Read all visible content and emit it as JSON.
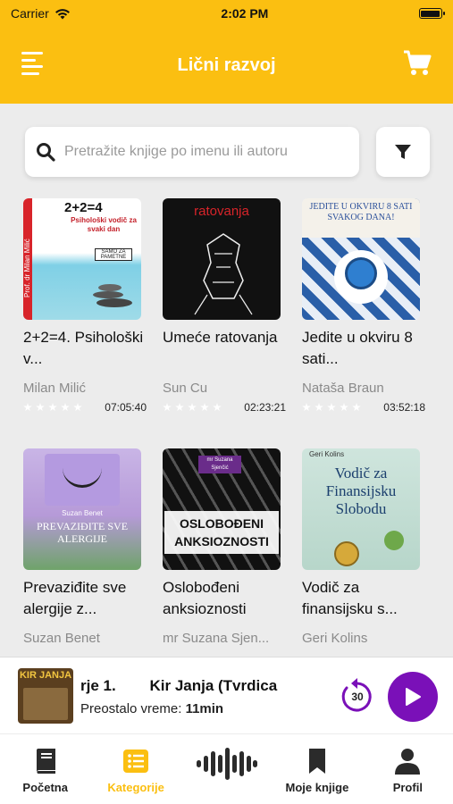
{
  "status_bar": {
    "carrier": "Carrier",
    "time": "2:02 PM"
  },
  "header": {
    "title": "Lični razvoj"
  },
  "search": {
    "placeholder": "Pretražite knjige po imenu ili autoru",
    "value": ""
  },
  "books": [
    {
      "title": "2+2=4. Psihološki v...",
      "author": "Milan Milić",
      "duration": "07:05:40",
      "cover_text": "2+2=4",
      "cover_sub": "Psihološki vodič za svaki dan",
      "cover_author": "Prof. dr Milan Milić",
      "cover_badge": "SAMO ZA PAMETNE"
    },
    {
      "title": "Umeće ratovanja",
      "author": "Sun Cu",
      "duration": "02:23:21",
      "cover_text": "ratovanja"
    },
    {
      "title": "Jedite u okviru 8 sati...",
      "author": "Nataša Braun",
      "duration": "03:52:18",
      "cover_text": "JEDITE U OKVIRU 8 SATI SVAKOG DANA!"
    },
    {
      "title": "Prevaziđite sve alergije z...",
      "author": "Suzan Benet",
      "duration": "",
      "cover_text": "PREVAZIĐITE SVE ALERGIJE",
      "cover_author": "Suzan Benet"
    },
    {
      "title": "Oslobođeni anksioznosti",
      "author": "mr Suzana Sjen...",
      "duration": "",
      "cover_text": "OSLOBOĐENI ANKSIOZNOSTI",
      "cover_author": "mr Suzana Sjenčić"
    },
    {
      "title": "Vodič za finansijsku s...",
      "author": "Geri Kolins",
      "duration": "",
      "cover_text": "Vodič za Finansijsku Slobodu",
      "cover_author": "Geri Kolins"
    }
  ],
  "player": {
    "track": "rje 1.        Kir Janja (Tvrdica",
    "remaining_label": "Preostalo vreme:",
    "remaining_value": "11min",
    "rewind_seconds": "30",
    "thumb_text": "KIR JANJA"
  },
  "tabs": [
    {
      "label": "Početna",
      "icon": "book-icon"
    },
    {
      "label": "Kategorije",
      "icon": "list-icon",
      "active": true
    },
    {
      "label": "",
      "icon": "audio-wave-icon"
    },
    {
      "label": "Moje knjige",
      "icon": "bookmark-icon"
    },
    {
      "label": "Profil",
      "icon": "profile-icon"
    }
  ],
  "colors": {
    "accent": "#fbbf11",
    "play": "#7a10b8",
    "background": "#ececec"
  }
}
